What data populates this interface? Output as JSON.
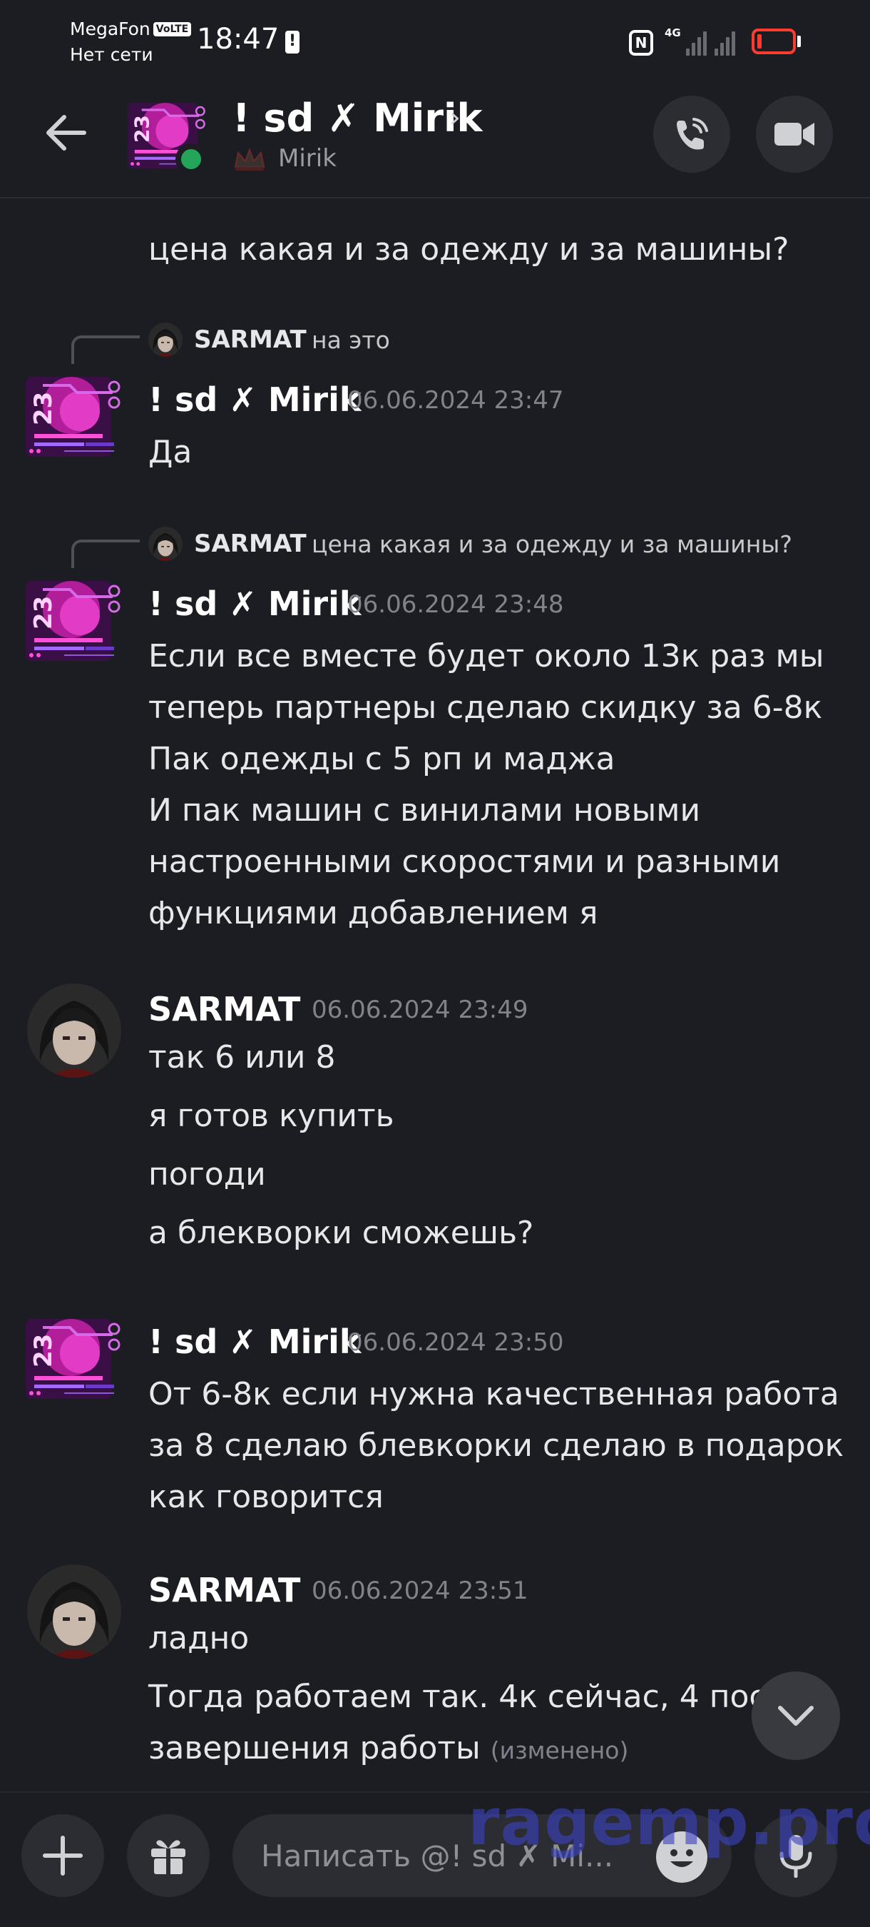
{
  "status_bar": {
    "carrier": "MegaFon",
    "volte": "VoLTE",
    "network_status": "Нет сети",
    "time": "18:47",
    "network_type": "4G",
    "battery_color": "#ff3b30"
  },
  "header": {
    "title": "! sd ✗ Mirik",
    "chevron": "›",
    "subtitle": "Mirik",
    "online_color": "#23a55a",
    "icons": {
      "back": "arrow-left-icon",
      "call": "phone-call-icon",
      "video": "video-camera-icon"
    }
  },
  "messages": {
    "partial_top": "цена какая и за одежду и за машины?",
    "group1": {
      "reply": {
        "name": "SARMAT",
        "text": "на это"
      },
      "author": "! sd ✗ Mirik",
      "timestamp": "06.06.2024 23:47",
      "lines": [
        "Да"
      ]
    },
    "group2": {
      "reply": {
        "name": "SARMAT",
        "text": "цена какая и за одежду и за машины?"
      },
      "author": "! sd ✗ Mirik",
      "timestamp": "06.06.2024 23:48",
      "lines": [
        "Если все вместе будет около 13к раз мы",
        "теперь партнеры сделаю скидку за 6-8к",
        "Пак одежды с 5 рп и маджа",
        "И пак машин с винилами новыми",
        "настроенными скоростями и разными",
        "функциями добавлением я"
      ]
    },
    "group3": {
      "author": "SARMAT",
      "timestamp": "06.06.2024 23:49",
      "lines": [
        "так 6 или 8",
        "я готов купить",
        "погоди",
        "а блекворки сможешь?"
      ]
    },
    "group4": {
      "author": "! sd ✗ Mirik",
      "timestamp": "06.06.2024 23:50",
      "lines": [
        "От 6-8к если нужна качественная работа",
        "за 8 сделаю блевкорки сделаю в подарок",
        "как говорится"
      ]
    },
    "group5": {
      "author": "SARMAT",
      "timestamp": "06.06.2024 23:51",
      "lines": [
        "ладно",
        "Тогда работаем так. 4к сейчас, 4 посл",
        "завершения работы"
      ],
      "edited": "(изменено)"
    }
  },
  "composer": {
    "placeholder": "Написать @! sd ✗ Mi...",
    "icons": {
      "plus": "plus-icon",
      "gift": "gift-icon",
      "emoji": "emoji-icon",
      "mic": "microphone-icon",
      "scroll": "chevron-down-icon"
    }
  },
  "watermark": "ragemp.pro"
}
